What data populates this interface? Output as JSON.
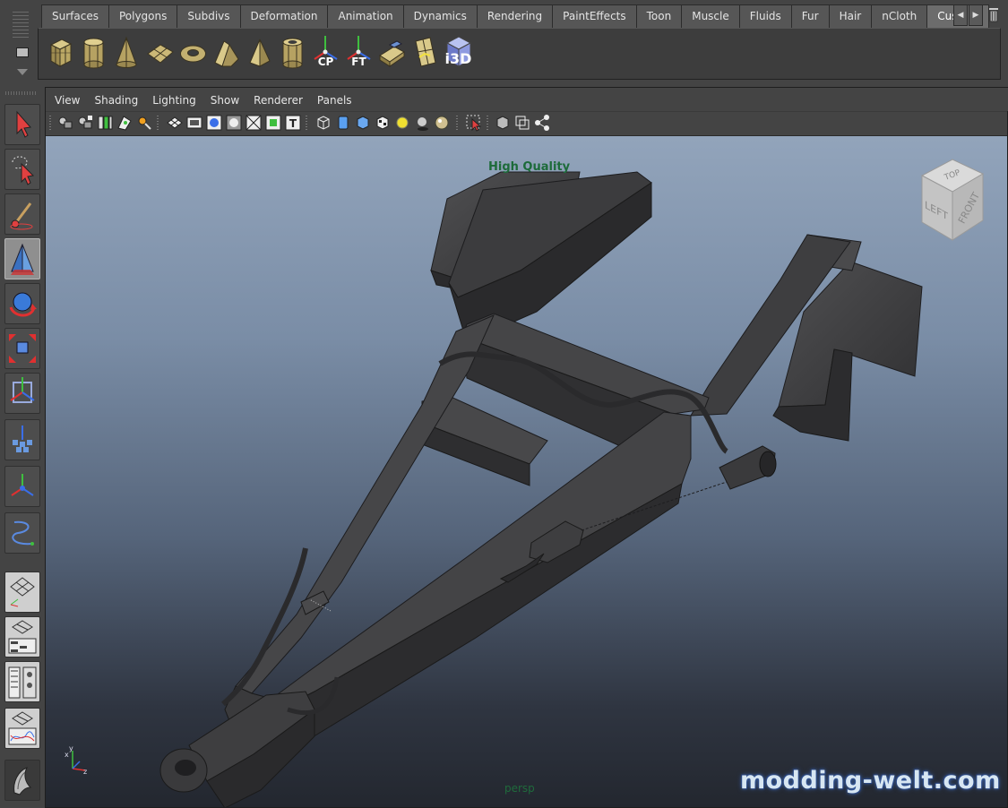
{
  "shelf": {
    "tabs": [
      "Surfaces",
      "Polygons",
      "Subdivs",
      "Deformation",
      "Animation",
      "Dynamics",
      "Rendering",
      "PaintEffects",
      "Toon",
      "Muscle",
      "Fluids",
      "Fur",
      "Hair",
      "nCloth",
      "Custom"
    ],
    "active_tab": "Custom",
    "icons": [
      {
        "name": "poly-cube-icon",
        "label": ""
      },
      {
        "name": "poly-cylinder-icon",
        "label": ""
      },
      {
        "name": "poly-cone-icon",
        "label": ""
      },
      {
        "name": "poly-plane-icon",
        "label": ""
      },
      {
        "name": "poly-torus-icon",
        "label": ""
      },
      {
        "name": "poly-prism-icon",
        "label": ""
      },
      {
        "name": "poly-pyramid-icon",
        "label": ""
      },
      {
        "name": "poly-pipe-icon",
        "label": ""
      },
      {
        "name": "center-pivot-icon",
        "label": "CP"
      },
      {
        "name": "freeze-transforms-icon",
        "label": "FT"
      },
      {
        "name": "extrude-icon",
        "label": ""
      },
      {
        "name": "uv-icon",
        "label": ""
      },
      {
        "name": "i3d-export-icon",
        "label": "i3D"
      }
    ]
  },
  "panel": {
    "menus": [
      "View",
      "Shading",
      "Lighting",
      "Show",
      "Renderer",
      "Panels"
    ]
  },
  "viewport": {
    "hq_label": "High Quality",
    "camera_label": "persp",
    "viewcube": {
      "top": "TOP",
      "left": "LEFT",
      "front": "FRONT"
    },
    "axes": {
      "x": "x",
      "y": "y",
      "z": "z"
    },
    "watermark": "modding-welt.com"
  },
  "colors": {
    "ui_bg": "#444444",
    "accent_blue": "#3a8fd8",
    "selected_tool": "#8f8f8f",
    "hq_text": "#1d6b3a"
  }
}
